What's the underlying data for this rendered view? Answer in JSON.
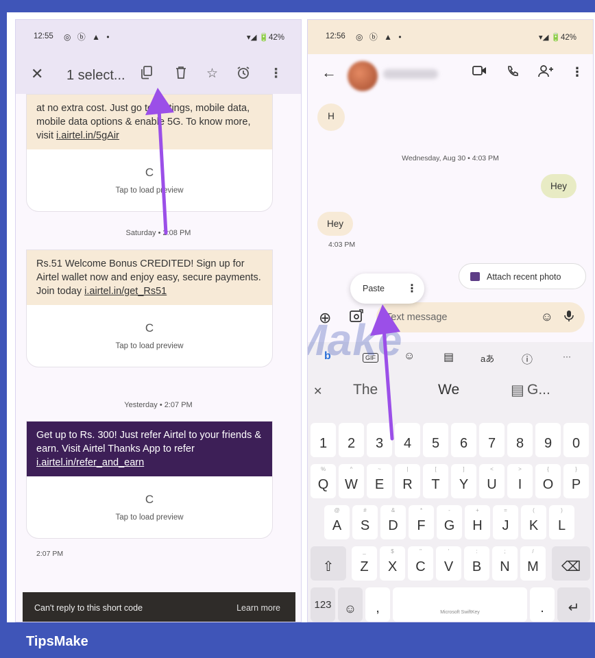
{
  "left": {
    "status": {
      "time": "12:55",
      "icons": "◎ ⓑ ▲ •",
      "right": "▾◢ 🔋42%"
    },
    "actionbar": {
      "close": "✕",
      "title": "1 select...",
      "copy_icon": "copy-icon",
      "delete_icon": "delete-icon",
      "star_icon": "star-icon",
      "snooze_icon": "snooze-icon",
      "more_icon": "more-icon"
    },
    "card1": {
      "text_before_link": "at no extra cost. Just go to settings, mobile data, mobile data options & enable 5G. To know more, visit ",
      "link": "i.airtel.in/5gAir",
      "refresh": "C",
      "tap": "Tap to load preview"
    },
    "date1": "Saturday • 2:08 PM",
    "card2": {
      "text_before_link": "Rs.51 Welcome Bonus CREDITED! Sign up for Airtel wallet now and enjoy easy, secure payments. Join today ",
      "link": "i.airtel.in/get_Rs51",
      "refresh": "C",
      "tap": "Tap to load preview"
    },
    "date2": "Yesterday • 2:07 PM",
    "card3": {
      "text_before_link": "Get up to Rs. 300! Just refer Airtel to your friends & earn. Visit Airtel Thanks App to refer ",
      "link": "i.airtel.in/refer_and_earn",
      "refresh": "C",
      "tap": "Tap to load preview"
    },
    "timestamp": "2:07 PM",
    "snackbar": {
      "text": "Can't reply to this short code",
      "action": "Learn more"
    }
  },
  "right": {
    "status": {
      "time": "12:56",
      "icons": "◎ ⓑ ▲ •",
      "right": "▾◢ 🔋42%"
    },
    "header": {
      "back": "←",
      "video_icon": "video-call-icon",
      "call_icon": "phone-icon",
      "add_icon": "add-person-icon",
      "more_icon": "more-icon"
    },
    "bubble_h": "H",
    "date": "Wednesday, Aug 30 • 4:03 PM",
    "bubble_out": "Hey",
    "bubble_in": "Hey",
    "bubble_in_time": "4:03 PM",
    "attach": "Attach recent photo",
    "paste": "Paste",
    "composer": {
      "placeholder": "Text message"
    },
    "toolbar": [
      "b",
      "GIF",
      "☺",
      "▤",
      "aあ",
      "ⓘ",
      "···"
    ],
    "suggestions": [
      "The",
      "We",
      "G..."
    ],
    "keys": {
      "numbers": [
        "1",
        "2",
        "3",
        "4",
        "5",
        "6",
        "7",
        "8",
        "9",
        "0"
      ],
      "row1": [
        "Q",
        "W",
        "E",
        "R",
        "T",
        "Y",
        "U",
        "I",
        "O",
        "P"
      ],
      "row1_sub": [
        "%",
        "^",
        "~",
        "|",
        "[",
        "]",
        "<",
        ">",
        "{",
        "}"
      ],
      "row2": [
        "A",
        "S",
        "D",
        "F",
        "G",
        "H",
        "J",
        "K",
        "L"
      ],
      "row2_sub": [
        "@",
        "#",
        "&",
        "*",
        "-",
        "+",
        "=",
        "(",
        ")"
      ],
      "row3": [
        "Z",
        "X",
        "C",
        "V",
        "B",
        "N",
        "M"
      ],
      "row3_sub": [
        "_",
        "$",
        "\"",
        "'",
        ":",
        ";",
        "/"
      ],
      "num_key": "123",
      "space_label": "Microsoft SwiftKey"
    }
  },
  "watermark": "TipsMake",
  "footer": "TipsMake",
  "colors": {
    "frame": "#3f55b8",
    "arrow": "#9b4fe8",
    "dark_card": "#3d1f57"
  }
}
